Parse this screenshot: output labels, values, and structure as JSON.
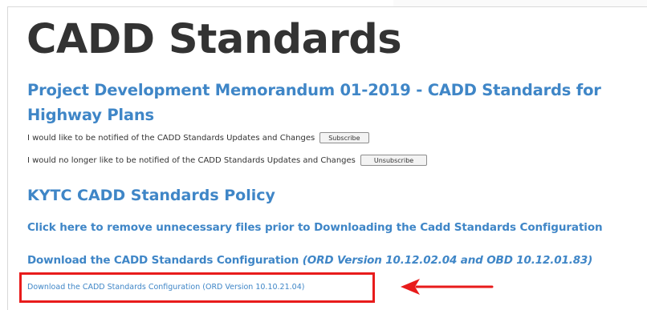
{
  "page": {
    "title": "CADD Standards",
    "memo_heading": "Project Development Memorandum 01-2019 - CADD Standards for Highway Plans",
    "subscribe_text": "I would like to be notified of the CADD Standards Updates and Changes",
    "subscribe_button": "Subscribe",
    "unsubscribe_text": "I would no longer like to be notified of the CADD Standards Updates and Changes",
    "unsubscribe_button": "Unsubscribe",
    "policy_heading": "KYTC CADD Standards Policy",
    "remove_files_link": "Click here to remove unnecessary files prior to Downloading the Cadd Standards Configuration",
    "download_config_link": "Download the CADD Standards Configuration",
    "download_config_version": "(ORD Version 10.12.02.04 and OBD 10.12.01.83)",
    "download_old_link": "Download the CADD Standards Configuration (ORD Version 10.10.21.04)"
  },
  "colors": {
    "link_blue": "#3f86c7",
    "title_gray": "#333333",
    "annotation_red": "#e81b1b"
  },
  "icons": {
    "annotation": "red-arrow-icon"
  }
}
